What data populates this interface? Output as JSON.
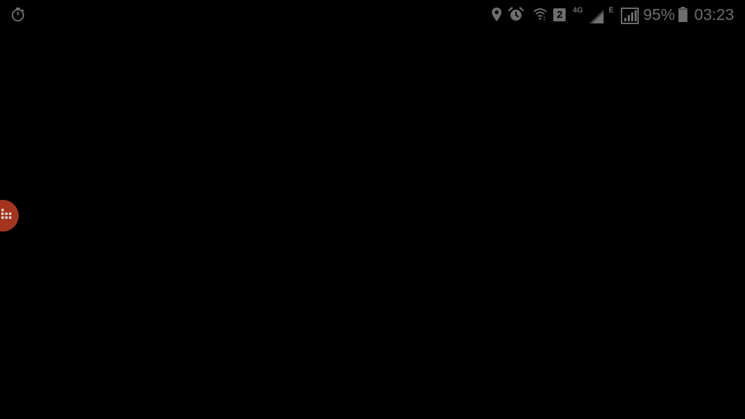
{
  "status_bar": {
    "left_icons": [
      "timer-icon"
    ],
    "right_icons": [
      "location-icon",
      "alarm-icon",
      "wifi-icon",
      "sim-2-badge",
      "signal-4g-icon",
      "signal-e-icon",
      "battery-icon"
    ],
    "sim_label": "2",
    "network_label_1": "4G",
    "network_label_2": "E",
    "battery_percent": "95%",
    "battery_level": 0.95,
    "time": "03:23"
  },
  "floating_button": {
    "icon": "grid-dots-icon",
    "color": "#a5341f"
  },
  "colors": {
    "background": "#000000",
    "status_foreground": "#6e6e6e"
  }
}
